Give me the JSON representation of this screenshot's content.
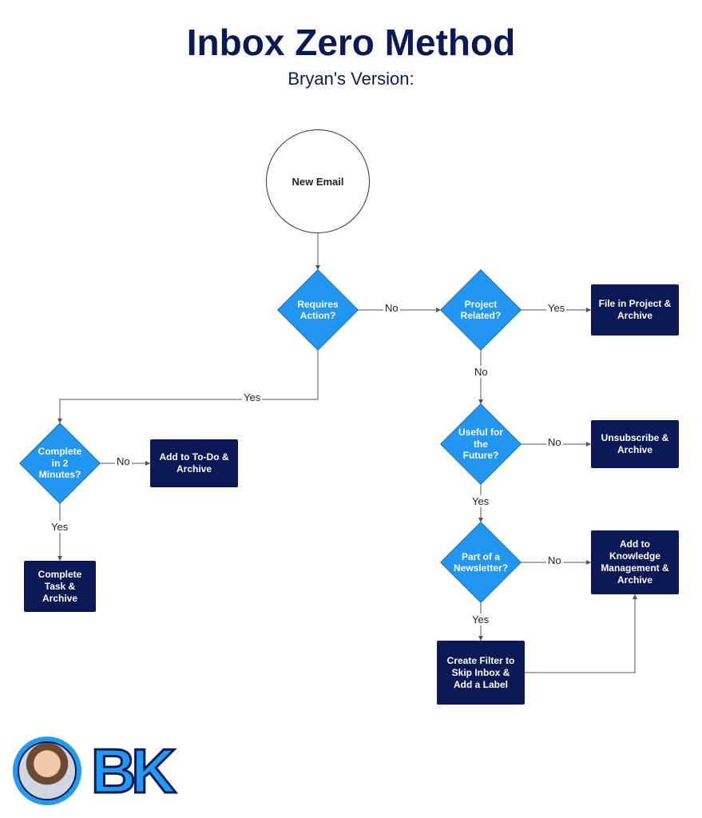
{
  "title": "Inbox Zero Method",
  "subtitle": "Bryan's Version:",
  "nodes": {
    "start": "New Email",
    "requires_action": "Requires Action?",
    "complete_2min": "Complete in 2 Minutes?",
    "add_todo": "Add to To-Do & Archive",
    "complete_task": "Complete Task & Archive",
    "project_related": "Project Related?",
    "file_project": "File in Project & Archive",
    "useful_future": "Useful for the Future?",
    "unsubscribe": "Unsubscribe & Archive",
    "part_newsletter": "Part of a Newsletter?",
    "add_knowledge": "Add to Knowledge Management & Archive",
    "create_filter": "Create Filter to Skip Inbox & Add a Label"
  },
  "edges": {
    "yes": "Yes",
    "no": "No"
  },
  "logo_text": "BK"
}
